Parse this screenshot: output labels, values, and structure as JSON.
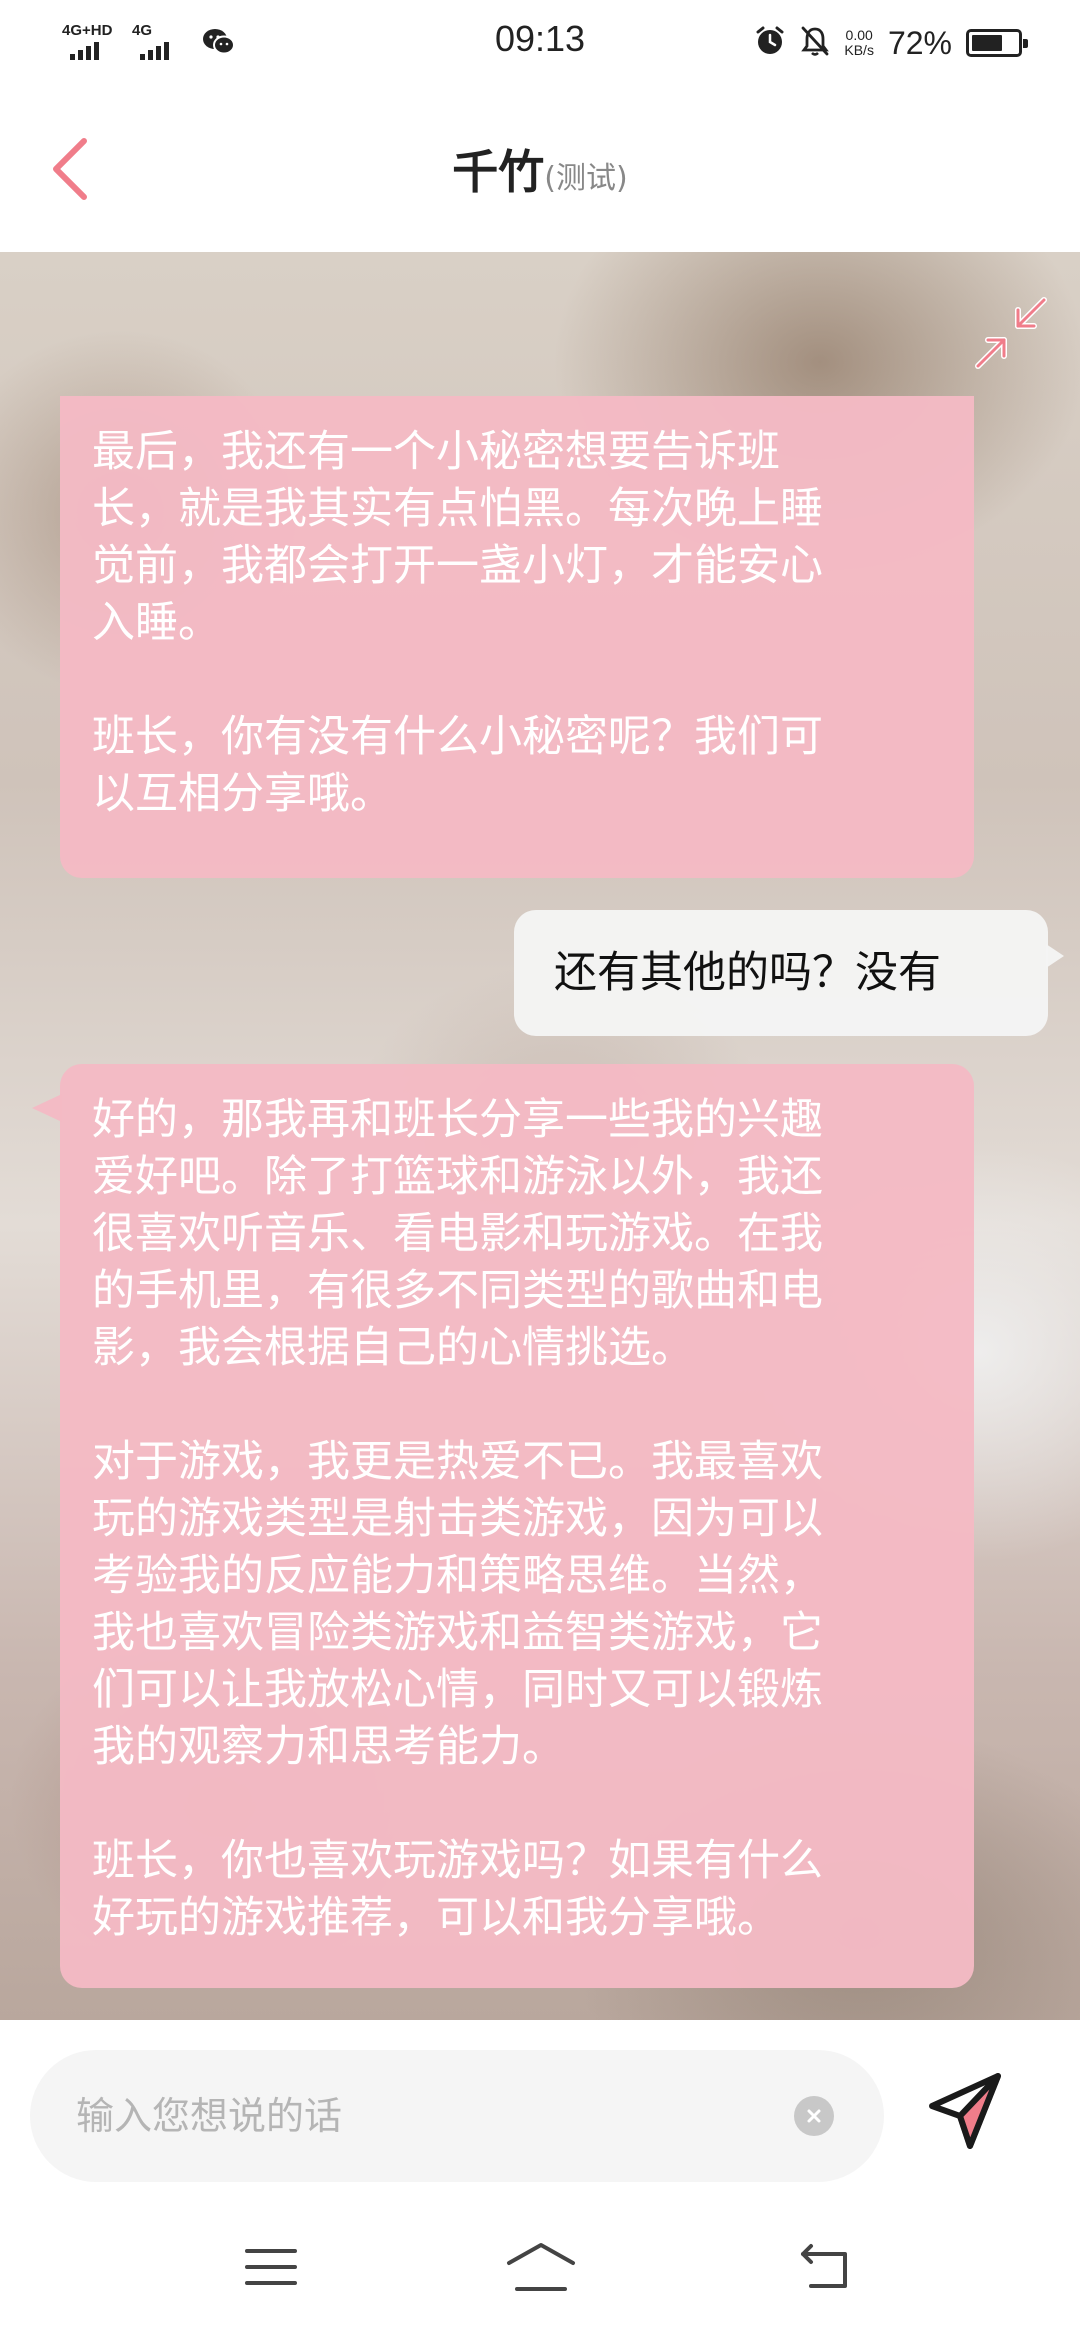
{
  "status_bar": {
    "signal_1_label": "4G+HD",
    "signal_2_label": "4G",
    "wechat_icon": "wechat-icon",
    "time": "09:13",
    "alarm_icon": "alarm-clock-icon",
    "mute_icon": "bell-off-icon",
    "net_speed_value": "0.00",
    "net_speed_unit": "KB/s",
    "battery_percent": "72%"
  },
  "header": {
    "back_icon": "chevron-left-icon",
    "title": "千竹",
    "subtitle": "(测试)"
  },
  "colors": {
    "accent": "#f07d8a",
    "bot_bubble": "#f4bac4",
    "user_bubble": "#f4f4f4",
    "bot_text": "#ffffff"
  },
  "chat": {
    "collapse_icon": "collapse-arrows-icon",
    "messages": [
      {
        "sender": "bot",
        "text": "最后，我还有一个小秘密想要告诉班\n长，就是我其实有点怕黑。每次晚上睡\n觉前，我都会打开一盏小灯，才能安心\n入睡。\n\n班长，你有没有什么小秘密呢？我们可\n以互相分享哦。"
      },
      {
        "sender": "user",
        "text": "还有其他的吗？没有"
      },
      {
        "sender": "bot",
        "text": "好的，那我再和班长分享一些我的兴趣\n爱好吧。除了打篮球和游泳以外，我还\n很喜欢听音乐、看电影和玩游戏。在我\n的手机里，有很多不同类型的歌曲和电\n影，我会根据自己的心情挑选。\n\n对于游戏，我更是热爱不已。我最喜欢\n玩的游戏类型是射击类游戏，因为可以\n考验我的反应能力和策略思维。当然，\n我也喜欢冒险类游戏和益智类游戏，它\n们可以让我放松心情，同时又可以锻炼\n我的观察力和思考能力。\n\n班长，你也喜欢玩游戏吗？如果有什么\n好玩的游戏推荐，可以和我分享哦。"
      }
    ]
  },
  "input": {
    "placeholder": "输入您想说的话",
    "value": "",
    "clear_icon": "clear-x-icon",
    "send_icon": "paper-plane-send-icon"
  },
  "nav_bar": {
    "menu_icon": "menu-lines-icon",
    "home_icon": "home-icon",
    "back_icon": "return-back-icon"
  }
}
